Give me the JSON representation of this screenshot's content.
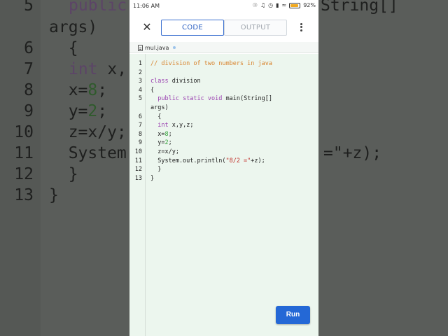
{
  "status": {
    "time": "11:06 AM",
    "battery": "92%"
  },
  "toolbar": {
    "code_tab": "CODE",
    "output_tab": "OUTPUT"
  },
  "file": {
    "name": "mul.java"
  },
  "editor": {
    "line_numbers": [
      "1",
      "2",
      "3",
      "4",
      "5",
      "",
      "6",
      "7",
      "8",
      "9",
      "10",
      "11",
      "12",
      "13"
    ],
    "lines": {
      "l1": "// division of two numbers in java",
      "l3_kw": "class",
      "l3_rest": " division",
      "l4": "{",
      "l5_indent": "  ",
      "l5_kw": "public static void",
      "l5_rest": " main(String[]",
      "l5b": "args)",
      "l6": "  {",
      "l7_indent": "  ",
      "l7_kw": "int",
      "l7_rest": " x,y,z;",
      "l8_a": "  x=",
      "l8_num": "8",
      "l8_b": ";",
      "l9_a": "  y=",
      "l9_num": "2",
      "l9_b": ";",
      "l10": "  z=x/y;",
      "l11_a": "  System.out.println(",
      "l11_str": "\"8/2 =\"",
      "l11_b": "+z);",
      "l12": "  }",
      "l13": "}"
    }
  },
  "run_button": "Run",
  "background": {
    "n5": "5",
    "t5_kw": "public",
    "t5_rest": "",
    "t5_right": "String[]",
    "t5b": "args)",
    "n6": "6",
    "t6": "  {",
    "n7": "7",
    "t7_kw": "int",
    "t7_rest": " x,",
    "n8": "8",
    "t8_a": "  x=",
    "t8_num": "8",
    "t8_b": ";",
    "n9": "9",
    "t9_a": "  y=",
    "t9_num": "2",
    "t9_b": ";",
    "n10": "10",
    "t10": "  z=x/y;",
    "n11": "11",
    "t11": "  System",
    "t11_right": "=\"+z);",
    "n12": "12",
    "t12": "  }",
    "n13": "13",
    "t13": "}"
  },
  "colors": {
    "accent": "#2468d6",
    "editor_bg": "#ecf6ee",
    "comment": "#d8822c",
    "keyword": "#9a40b0",
    "number": "#34a23a",
    "string": "#c2302a"
  }
}
